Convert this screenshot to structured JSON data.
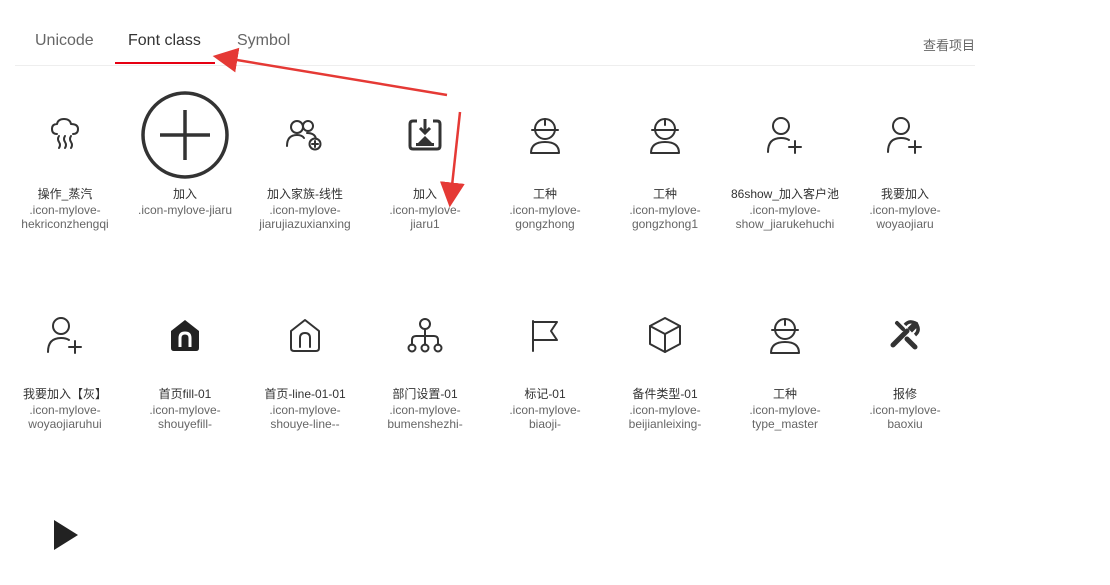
{
  "tabs": [
    {
      "label": "Unicode"
    },
    {
      "label": "Font class"
    },
    {
      "label": "Symbol"
    }
  ],
  "project_link": "查看项目",
  "colors": {
    "accent": "#e60012",
    "icon": "#333333"
  },
  "icons": [
    {
      "name": "操作_蒸汽",
      "cls1": ".icon-mylove-",
      "cls2": "hekriconzhengqi",
      "icon": "steam-icon"
    },
    {
      "name": "加入",
      "cls1": ".icon-mylove-jiaru",
      "cls2": "",
      "icon": "circle-plus-icon"
    },
    {
      "name": "加入家族-线性",
      "cls1": ".icon-mylove-",
      "cls2": "jiarujiazuxianxing",
      "icon": "family-add-icon"
    },
    {
      "name": "加入",
      "cls1": ".icon-mylove-",
      "cls2": "jiaru1",
      "icon": "box-download-icon"
    },
    {
      "name": "工种",
      "cls1": ".icon-mylove-",
      "cls2": "gongzhong",
      "icon": "worker-icon"
    },
    {
      "name": "工种",
      "cls1": ".icon-mylove-",
      "cls2": "gongzhong1",
      "icon": "worker-icon"
    },
    {
      "name": "86show_加入客户池",
      "cls1": ".icon-mylove-",
      "cls2": "show_jiarukehuchi",
      "icon": "user-add-icon"
    },
    {
      "name": "我要加入",
      "cls1": ".icon-mylove-",
      "cls2": "woyaojiaru",
      "icon": "user-add-icon"
    },
    {
      "name": "我要加入【灰】",
      "cls1": ".icon-mylove-",
      "cls2": "woyaojiaruhui",
      "icon": "user-add-icon"
    },
    {
      "name": "首页fill-01",
      "cls1": ".icon-mylove-",
      "cls2": "shouyefill-",
      "icon": "home-fill-icon"
    },
    {
      "name": "首页-line-01-01",
      "cls1": ".icon-mylove-",
      "cls2": "shouye-line--",
      "icon": "home-line-icon"
    },
    {
      "name": "部门设置-01",
      "cls1": ".icon-mylove-",
      "cls2": "bumenshezhi-",
      "icon": "org-chart-icon"
    },
    {
      "name": "标记-01",
      "cls1": ".icon-mylove-",
      "cls2": "biaoji-",
      "icon": "flag-icon"
    },
    {
      "name": "备件类型-01",
      "cls1": ".icon-mylove-",
      "cls2": "beijianleixing-",
      "icon": "cube-icon"
    },
    {
      "name": "工种",
      "cls1": ".icon-mylove-",
      "cls2": "type_master",
      "icon": "worker-icon"
    },
    {
      "name": "报修",
      "cls1": ".icon-mylove-",
      "cls2": "baoxiu",
      "icon": "tools-icon"
    },
    {
      "name": "",
      "cls1": "",
      "cls2": "",
      "icon": "play-icon"
    }
  ]
}
